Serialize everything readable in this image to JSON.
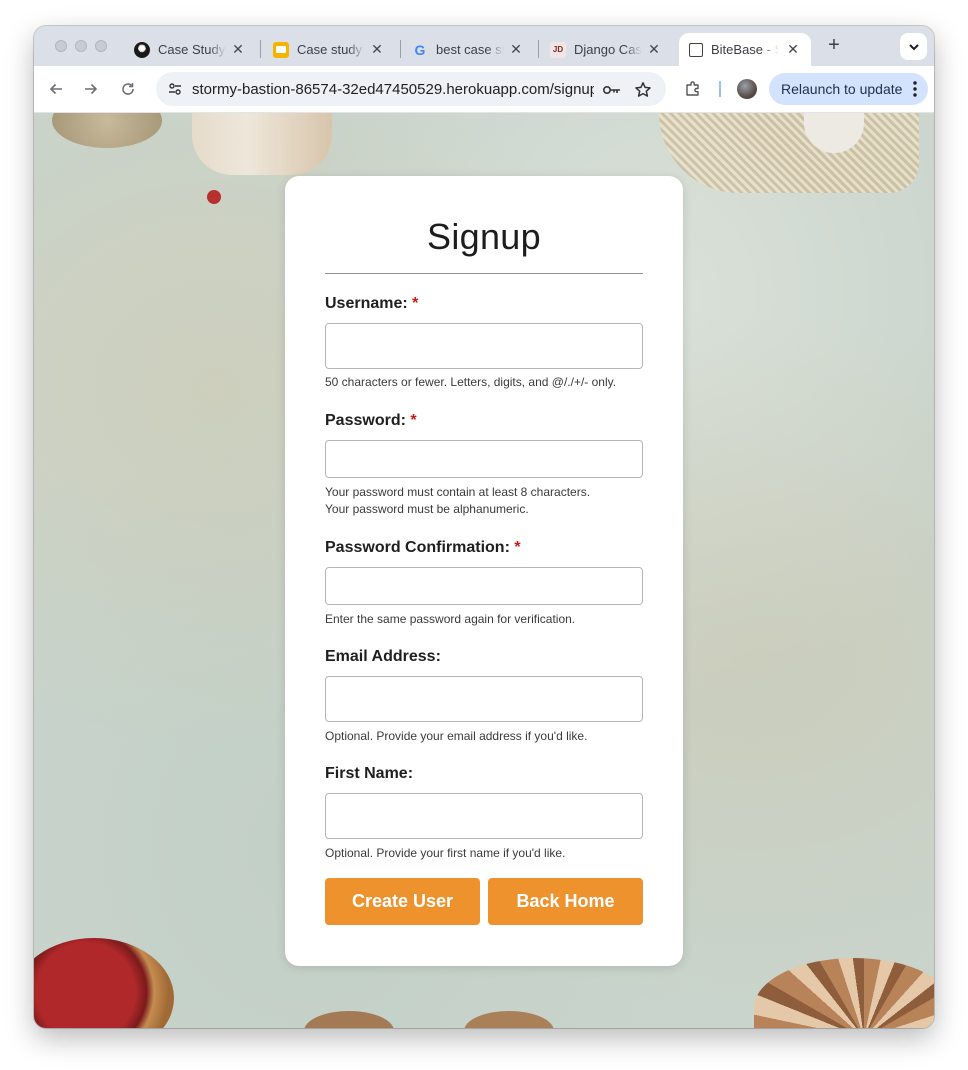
{
  "browser": {
    "tabs": [
      {
        "title": "Case Study"
      },
      {
        "title": "Case study"
      },
      {
        "title": "best case study"
      },
      {
        "title": "Django Case"
      },
      {
        "title": "BiteBase - Signup"
      }
    ],
    "url": "stormy-bastion-86574-32ed47450529.herokuapp.com/signup/",
    "relaunch_label": "Relaunch to update"
  },
  "form": {
    "title": "Signup",
    "required_mark": "*",
    "fields": [
      {
        "label": "Username:",
        "required": true,
        "value": "",
        "help": [
          "50 characters or fewer. Letters, digits, and @/./+/- only."
        ]
      },
      {
        "label": "Password:",
        "required": true,
        "value": "",
        "help": [
          "Your password must contain at least 8 characters.",
          "Your password must be alphanumeric."
        ]
      },
      {
        "label": "Password Confirmation:",
        "required": true,
        "value": "",
        "help": [
          "Enter the same password again for verification."
        ]
      },
      {
        "label": "Email Address:",
        "required": false,
        "value": "",
        "help": [
          "Optional. Provide your email address if you'd like."
        ]
      },
      {
        "label": "First Name:",
        "required": false,
        "value": "",
        "help": [
          "Optional. Provide your first name if you'd like."
        ]
      }
    ],
    "buttons": {
      "create": "Create User",
      "back": "Back Home"
    }
  },
  "colors": {
    "accent": "#ee922e",
    "required": "#d01818",
    "relaunch_bg": "#d3e3fd"
  }
}
